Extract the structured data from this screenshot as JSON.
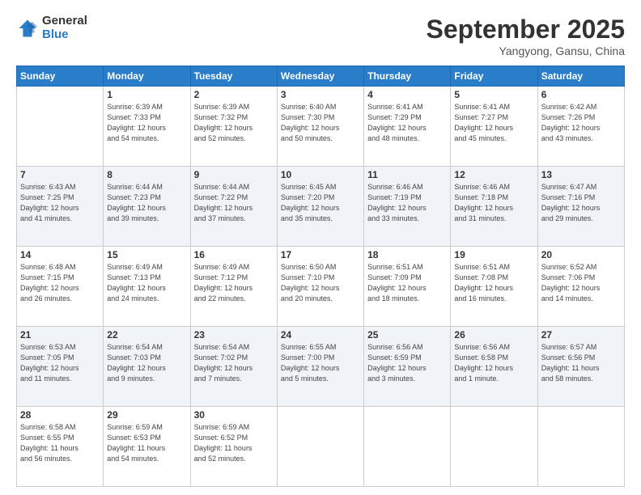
{
  "header": {
    "logo": {
      "general": "General",
      "blue": "Blue"
    },
    "title": "September 2025",
    "location": "Yangyong, Gansu, China"
  },
  "weekdays": [
    "Sunday",
    "Monday",
    "Tuesday",
    "Wednesday",
    "Thursday",
    "Friday",
    "Saturday"
  ],
  "weeks": [
    [
      {
        "day": "",
        "info": ""
      },
      {
        "day": "1",
        "info": "Sunrise: 6:39 AM\nSunset: 7:33 PM\nDaylight: 12 hours\nand 54 minutes."
      },
      {
        "day": "2",
        "info": "Sunrise: 6:39 AM\nSunset: 7:32 PM\nDaylight: 12 hours\nand 52 minutes."
      },
      {
        "day": "3",
        "info": "Sunrise: 6:40 AM\nSunset: 7:30 PM\nDaylight: 12 hours\nand 50 minutes."
      },
      {
        "day": "4",
        "info": "Sunrise: 6:41 AM\nSunset: 7:29 PM\nDaylight: 12 hours\nand 48 minutes."
      },
      {
        "day": "5",
        "info": "Sunrise: 6:41 AM\nSunset: 7:27 PM\nDaylight: 12 hours\nand 45 minutes."
      },
      {
        "day": "6",
        "info": "Sunrise: 6:42 AM\nSunset: 7:26 PM\nDaylight: 12 hours\nand 43 minutes."
      }
    ],
    [
      {
        "day": "7",
        "info": "Sunrise: 6:43 AM\nSunset: 7:25 PM\nDaylight: 12 hours\nand 41 minutes."
      },
      {
        "day": "8",
        "info": "Sunrise: 6:44 AM\nSunset: 7:23 PM\nDaylight: 12 hours\nand 39 minutes."
      },
      {
        "day": "9",
        "info": "Sunrise: 6:44 AM\nSunset: 7:22 PM\nDaylight: 12 hours\nand 37 minutes."
      },
      {
        "day": "10",
        "info": "Sunrise: 6:45 AM\nSunset: 7:20 PM\nDaylight: 12 hours\nand 35 minutes."
      },
      {
        "day": "11",
        "info": "Sunrise: 6:46 AM\nSunset: 7:19 PM\nDaylight: 12 hours\nand 33 minutes."
      },
      {
        "day": "12",
        "info": "Sunrise: 6:46 AM\nSunset: 7:18 PM\nDaylight: 12 hours\nand 31 minutes."
      },
      {
        "day": "13",
        "info": "Sunrise: 6:47 AM\nSunset: 7:16 PM\nDaylight: 12 hours\nand 29 minutes."
      }
    ],
    [
      {
        "day": "14",
        "info": "Sunrise: 6:48 AM\nSunset: 7:15 PM\nDaylight: 12 hours\nand 26 minutes."
      },
      {
        "day": "15",
        "info": "Sunrise: 6:49 AM\nSunset: 7:13 PM\nDaylight: 12 hours\nand 24 minutes."
      },
      {
        "day": "16",
        "info": "Sunrise: 6:49 AM\nSunset: 7:12 PM\nDaylight: 12 hours\nand 22 minutes."
      },
      {
        "day": "17",
        "info": "Sunrise: 6:50 AM\nSunset: 7:10 PM\nDaylight: 12 hours\nand 20 minutes."
      },
      {
        "day": "18",
        "info": "Sunrise: 6:51 AM\nSunset: 7:09 PM\nDaylight: 12 hours\nand 18 minutes."
      },
      {
        "day": "19",
        "info": "Sunrise: 6:51 AM\nSunset: 7:08 PM\nDaylight: 12 hours\nand 16 minutes."
      },
      {
        "day": "20",
        "info": "Sunrise: 6:52 AM\nSunset: 7:06 PM\nDaylight: 12 hours\nand 14 minutes."
      }
    ],
    [
      {
        "day": "21",
        "info": "Sunrise: 6:53 AM\nSunset: 7:05 PM\nDaylight: 12 hours\nand 11 minutes."
      },
      {
        "day": "22",
        "info": "Sunrise: 6:54 AM\nSunset: 7:03 PM\nDaylight: 12 hours\nand 9 minutes."
      },
      {
        "day": "23",
        "info": "Sunrise: 6:54 AM\nSunset: 7:02 PM\nDaylight: 12 hours\nand 7 minutes."
      },
      {
        "day": "24",
        "info": "Sunrise: 6:55 AM\nSunset: 7:00 PM\nDaylight: 12 hours\nand 5 minutes."
      },
      {
        "day": "25",
        "info": "Sunrise: 6:56 AM\nSunset: 6:59 PM\nDaylight: 12 hours\nand 3 minutes."
      },
      {
        "day": "26",
        "info": "Sunrise: 6:56 AM\nSunset: 6:58 PM\nDaylight: 12 hours\nand 1 minute."
      },
      {
        "day": "27",
        "info": "Sunrise: 6:57 AM\nSunset: 6:56 PM\nDaylight: 11 hours\nand 58 minutes."
      }
    ],
    [
      {
        "day": "28",
        "info": "Sunrise: 6:58 AM\nSunset: 6:55 PM\nDaylight: 11 hours\nand 56 minutes."
      },
      {
        "day": "29",
        "info": "Sunrise: 6:59 AM\nSunset: 6:53 PM\nDaylight: 11 hours\nand 54 minutes."
      },
      {
        "day": "30",
        "info": "Sunrise: 6:59 AM\nSunset: 6:52 PM\nDaylight: 11 hours\nand 52 minutes."
      },
      {
        "day": "",
        "info": ""
      },
      {
        "day": "",
        "info": ""
      },
      {
        "day": "",
        "info": ""
      },
      {
        "day": "",
        "info": ""
      }
    ]
  ]
}
